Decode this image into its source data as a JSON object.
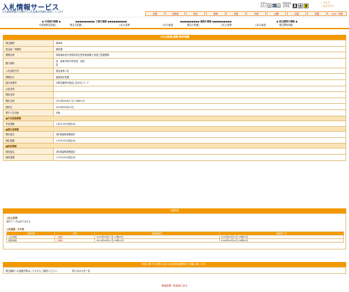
{
  "header": {
    "title": "入札情報サービス",
    "subtitle": "公共調達情報の公開から入札結果の情報を提供しています",
    "font_size_label": "文字の大きさ",
    "font_sizes": [
      "大",
      "中",
      "小"
    ],
    "color_label": "背景色を文字色",
    "colors": [
      "黒",
      "白",
      "黄"
    ],
    "help": "ヘルプ",
    "logout": "ログアウト"
  },
  "region_tabs": [
    "全国",
    "北海道",
    "東北",
    "関東",
    "北陸",
    "中部",
    "近畿",
    "中国",
    "四国",
    "九州・沖縄"
  ],
  "categories": [
    {
      "head": "中長期の情報",
      "subs": [
        "中長期発注見通し"
      ]
    },
    {
      "head": "工事の情報",
      "subs": [
        "発注の見通し",
        "入札公告等",
        "入札の経過"
      ]
    },
    {
      "head": "業務の情報",
      "subs": [
        "発注の見通し",
        "入札公告等",
        "入札の経過"
      ]
    },
    {
      "head": "発注標準の情報",
      "subs": [
        "発注標準情報"
      ]
    }
  ],
  "detail": {
    "title": "入札の経過(業務)案件概要",
    "rows": [
      {
        "label": "発注機関",
        "value": "岐阜県",
        "type": "row"
      },
      {
        "label": "担当部・事務所",
        "value": "管財課",
        "type": "row"
      },
      {
        "label": "業務名称",
        "value": "県岐阜総合庁舎特別高圧受変電設備工事施工監理業務",
        "type": "row"
      },
      {
        "label": "履行場所",
        "value": "自　岐阜市県庁所在地　地内\n至",
        "type": "tall"
      },
      {
        "label": "入札契約方式",
        "value": "指名競争入札",
        "type": "row"
      },
      {
        "label": "業務区分",
        "value": "建築設計監理",
        "type": "row"
      },
      {
        "label": "設計書番号",
        "value": "※発注機関が独自に定めるコード",
        "type": "row"
      },
      {
        "label": "公告日時",
        "value": "",
        "type": "row"
      },
      {
        "label": "閲覧日時",
        "value": "",
        "type": "row"
      },
      {
        "label": "開札日時",
        "value": "2024年06月17日 10時01分",
        "type": "row"
      },
      {
        "label": "契約日",
        "value": "2024年06月20日",
        "type": "row"
      },
      {
        "label": "電子入札対象",
        "value": "対象",
        "type": "row"
      },
      {
        "label": "■予定価格情報",
        "value": "",
        "type": "sec"
      },
      {
        "label": "予定価格",
        "value": "1,604,900(税込み)",
        "type": "row"
      },
      {
        "label": "■落札者情報",
        "value": "",
        "type": "sec"
      },
      {
        "label": "落札者名",
        "value": "(株)東建築設備設計",
        "type": "row"
      },
      {
        "label": "落札価格",
        "value": "1,529,000(税込み)",
        "type": "row"
      },
      {
        "label": "■契約情報",
        "value": "",
        "type": "sec"
      },
      {
        "label": "契約者名",
        "value": "(株)東建築設備設計",
        "type": "row"
      },
      {
        "label": "契約金額",
        "value": "1,529,000(税込み)",
        "type": "row"
      }
    ]
  },
  "notices": {
    "title": "公開文書",
    "attachment_head": "入札公告等",
    "attachment_text": "添付データはありません",
    "schedule_head": "入札経過・その他",
    "schedule_columns": [
      "文書名称",
      "状態",
      "掲載開始日",
      "掲載終了日"
    ],
    "schedule_rows": [
      [
        "入札情報",
        "公開中",
        "2024年06月17日 10時06分",
        "2026年06月01日 00時00分"
      ],
      [
        "契約情報",
        "公開中",
        "2024年06月27日 09時13分",
        "2026年04月01日 00時00分"
      ]
    ]
  },
  "contact": {
    "title": "内容に関するお問い合わせは各発注機関までお願い致します。",
    "text": "発注機関への連絡先等はこちらからご確認ください。",
    "link": "問い合わせ先一覧"
  },
  "back_link": "検索結果一覧画面に戻る"
}
